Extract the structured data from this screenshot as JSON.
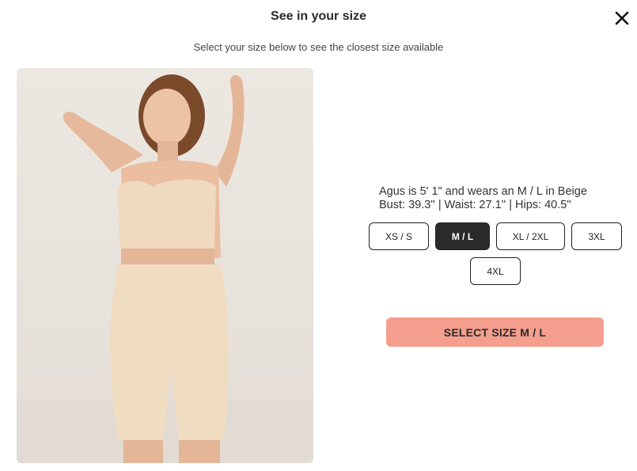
{
  "modal": {
    "title": "See in your size",
    "subtitle": "Select your size below to see the closest size available",
    "close_icon": "close-icon"
  },
  "model": {
    "line1": "Agus is 5' 1\" and wears an M / L in Beige",
    "line2": "Bust: 39.3'' | Waist: 27.1'' | Hips: 40.5''"
  },
  "sizes": {
    "options": [
      "XS / S",
      "M / L",
      "XL / 2XL",
      "3XL",
      "4XL"
    ],
    "selected": "M / L"
  },
  "cta": {
    "label": "SELECT SIZE M / L",
    "color": "#f49f8e"
  }
}
